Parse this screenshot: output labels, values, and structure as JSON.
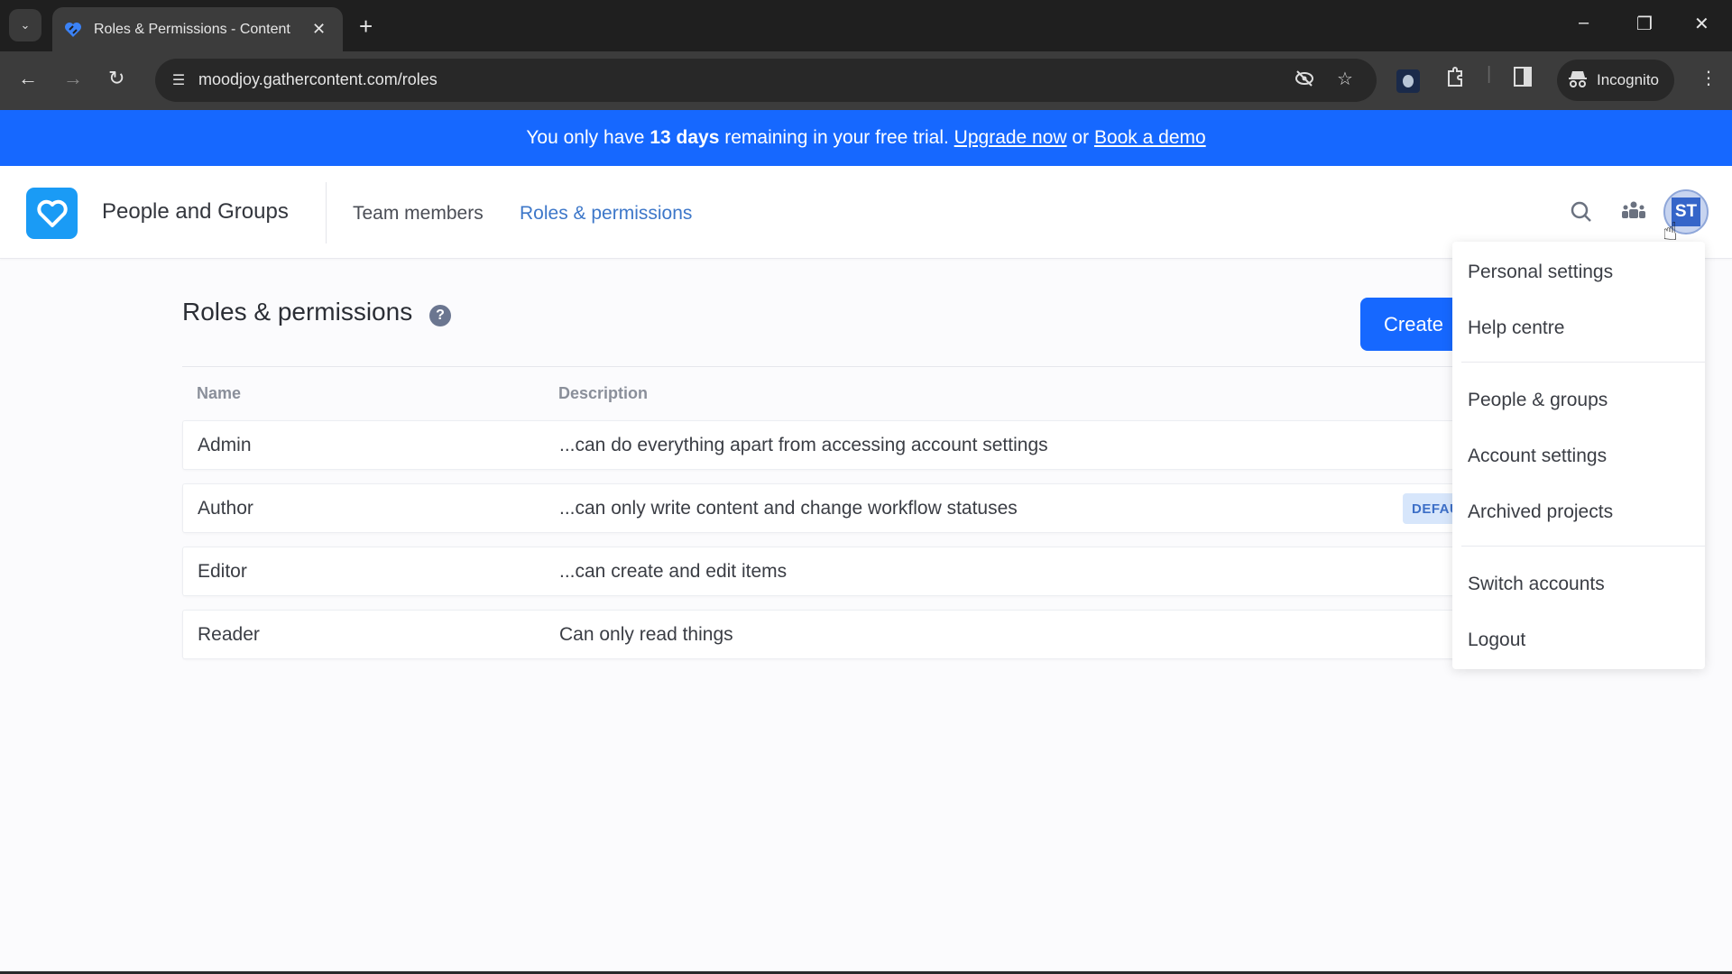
{
  "browser": {
    "tab_title": "Roles & Permissions - Content",
    "url": "moodjoy.gathercontent.com/roles",
    "incognito_label": "Incognito",
    "icons": {
      "tab_search": "chevron-down",
      "favicon": "gathercontent-heart",
      "close_tab": "close",
      "new_tab": "plus",
      "back": "arrow-left",
      "forward": "arrow-right",
      "reload": "reload",
      "site_info": "tune",
      "eye_off": "eye-slash",
      "bookmark": "star",
      "extensions": "puzzle",
      "side_panel": "sidebar",
      "menu": "kebab"
    }
  },
  "banner": {
    "prefix": "You only have ",
    "days": "13 days",
    "middle": " remaining in your free trial. ",
    "upgrade_link": "Upgrade now",
    "or": " or ",
    "demo_link": "Book a demo",
    "color": "#1668ff"
  },
  "header": {
    "app_title": "People and Groups",
    "nav": [
      {
        "label": "Team members",
        "active": false
      },
      {
        "label": "Roles & permissions",
        "active": true
      }
    ],
    "avatar_initials": "ST",
    "accent_color": "#3d77c9"
  },
  "main": {
    "title": "Roles & permissions",
    "help_symbol": "?",
    "create_button_label": "Create",
    "table": {
      "columns": [
        "Name",
        "Description"
      ],
      "rows": [
        {
          "name": "Admin",
          "description": "...can do everything apart from accessing account settings",
          "badge": null
        },
        {
          "name": "Author",
          "description": "...can only write content and change workflow statuses",
          "badge": "DEFAULT"
        },
        {
          "name": "Editor",
          "description": "...can create and edit items",
          "badge": null
        },
        {
          "name": "Reader",
          "description": "Can only read things",
          "badge": null
        }
      ],
      "visible_badge_text": "DEFAU"
    }
  },
  "user_menu": {
    "groups": [
      [
        "Personal settings",
        "Help centre"
      ],
      [
        "People & groups",
        "Account settings",
        "Archived projects"
      ],
      [
        "Switch accounts",
        "Logout"
      ]
    ],
    "items": [
      "Personal settings",
      "Help centre",
      "People & groups",
      "Account settings",
      "Archived projects",
      "Switch accounts",
      "Logout"
    ]
  }
}
